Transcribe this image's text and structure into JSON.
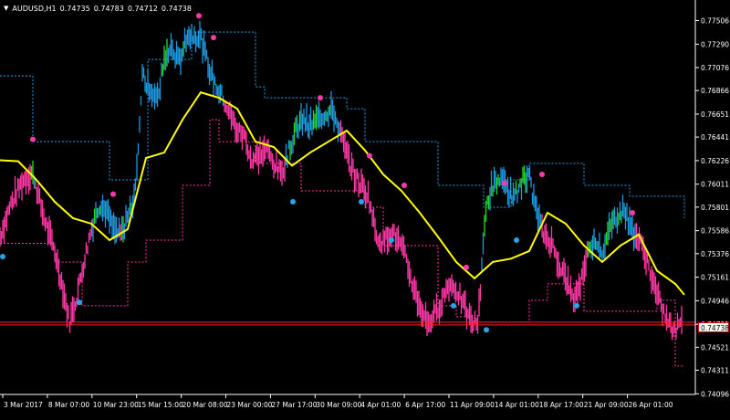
{
  "symbol": "AUDUSD,H1",
  "ohlc": [
    "0.74735",
    "0.74783",
    "0.74712",
    "0.74738"
  ],
  "current_price": "0.74738",
  "colors": {
    "background": "#000000",
    "grid_text": "#ffffff",
    "bull_candles": "#1e9be0",
    "bear_candles": "#ff3aa8",
    "strong_candles": "#22dd22",
    "midline": "#ffff00",
    "upper_band": "#29a4e6",
    "lower_band": "#ff3aa8",
    "price_line": "#ff2222"
  },
  "chart_data": {
    "type": "line",
    "xlabel": "",
    "ylabel": "",
    "ylim": [
      0.7409,
      0.7761
    ],
    "y_ticks": [
      "0.77506",
      "0.77290",
      "0.77076",
      "0.76866",
      "0.76651",
      "0.76441",
      "0.76226",
      "0.76011",
      "0.75801",
      "0.75586",
      "0.75376",
      "0.75161",
      "0.74946",
      "0.74731",
      "0.74521",
      "0.74311",
      "0.74096"
    ],
    "x_ticks": [
      "3 Mar 2017",
      "8 Mar 07:00",
      "10 Mar 23:00",
      "15 Mar 15:00",
      "20 Mar 08:00",
      "23 Mar 00:00",
      "27 Mar 17:00",
      "30 Mar 09:00",
      "4 Apr 01:00",
      "6 Apr 17:00",
      "11 Apr 09:00",
      "14 Apr 01:00",
      "18 Apr 17:00",
      "21 Apr 09:00",
      "26 Apr 01:00"
    ],
    "series": [
      {
        "role": "price",
        "x": [
          0,
          12,
          24,
          36,
          44,
          52,
          60,
          68,
          76,
          84,
          92,
          100,
          108,
          116,
          124,
          132,
          140,
          148,
          156,
          164,
          172,
          180,
          188,
          196,
          204,
          212,
          220,
          228,
          236,
          244,
          252,
          260,
          268,
          276,
          284,
          292,
          300,
          308,
          316,
          324,
          332,
          340,
          348,
          356,
          364,
          372,
          380,
          388,
          396,
          404,
          412,
          420,
          428,
          436,
          444,
          452,
          460,
          468,
          476,
          484,
          492,
          500,
          508,
          516,
          524,
          532,
          540,
          548,
          556,
          564,
          572,
          580,
          588,
          596,
          604,
          612,
          620,
          628,
          636,
          644,
          652,
          660,
          668,
          676,
          684,
          692,
          700,
          708,
          716,
          724,
          732,
          740,
          748
        ],
        "y": [
          0.7553,
          0.7583,
          0.7603,
          0.7613,
          0.7583,
          0.756,
          0.754,
          0.751,
          0.7475,
          0.7498,
          0.753,
          0.756,
          0.758,
          0.7578,
          0.756,
          0.7555,
          0.757,
          0.759,
          0.77,
          0.769,
          0.7675,
          0.7715,
          0.7725,
          0.7712,
          0.7735,
          0.7738,
          0.7735,
          0.771,
          0.7692,
          0.768,
          0.7665,
          0.765,
          0.7645,
          0.7622,
          0.7628,
          0.7633,
          0.762,
          0.761,
          0.763,
          0.765,
          0.766,
          0.7655,
          0.766,
          0.7665,
          0.767,
          0.765,
          0.7628,
          0.761,
          0.76,
          0.759,
          0.7555,
          0.7548,
          0.7558,
          0.755,
          0.7535,
          0.751,
          0.749,
          0.7475,
          0.748,
          0.7495,
          0.751,
          0.7505,
          0.749,
          0.7475,
          0.7475,
          0.758,
          0.76,
          0.7605,
          0.7595,
          0.759,
          0.7603,
          0.7608,
          0.7575,
          0.7555,
          0.7548,
          0.753,
          0.7515,
          0.7495,
          0.751,
          0.754,
          0.755,
          0.754,
          0.756,
          0.7573,
          0.7577,
          0.756,
          0.755,
          0.7535,
          0.751,
          0.749,
          0.7475,
          0.7465,
          0.7485
        ]
      },
      {
        "role": "midline",
        "x": [
          0,
          20,
          40,
          60,
          80,
          100,
          120,
          140,
          160,
          180,
          200,
          220,
          240,
          260,
          280,
          300,
          320,
          340,
          360,
          380,
          400,
          420,
          440,
          460,
          480,
          500,
          520,
          540,
          560,
          580,
          600,
          620,
          640,
          660,
          680,
          700,
          720,
          740,
          750
        ],
        "y": [
          0.7623,
          0.7622,
          0.7605,
          0.7585,
          0.757,
          0.7565,
          0.755,
          0.756,
          0.7625,
          0.763,
          0.766,
          0.7685,
          0.768,
          0.767,
          0.764,
          0.7635,
          0.7618,
          0.763,
          0.764,
          0.765,
          0.7632,
          0.761,
          0.7595,
          0.7575,
          0.7553,
          0.753,
          0.7515,
          0.753,
          0.7533,
          0.754,
          0.7575,
          0.7565,
          0.7545,
          0.753,
          0.7545,
          0.7555,
          0.7522,
          0.751,
          0.75
        ]
      },
      {
        "role": "upper_band",
        "x": [
          0,
          24,
          36,
          90,
          120,
          150,
          162,
          200,
          210,
          240,
          280,
          290,
          330,
          380,
          400,
          440,
          480,
          500,
          530,
          560,
          580,
          610,
          640,
          680,
          690,
          730,
          750
        ],
        "y": [
          0.77,
          0.77,
          0.764,
          0.764,
          0.7605,
          0.7605,
          0.7715,
          0.7715,
          0.774,
          0.774,
          0.769,
          0.768,
          0.768,
          0.767,
          0.764,
          0.764,
          0.76,
          0.76,
          0.758,
          0.7605,
          0.762,
          0.762,
          0.76,
          0.76,
          0.759,
          0.759,
          0.757
        ]
      },
      {
        "role": "lower_band",
        "x": [
          0,
          50,
          60,
          90,
          140,
          160,
          200,
          230,
          240,
          280,
          320,
          330,
          380,
          400,
          420,
          480,
          500,
          520,
          540,
          580,
          600,
          640,
          680,
          720,
          740,
          750
        ],
        "y": [
          0.7547,
          0.7547,
          0.753,
          0.749,
          0.753,
          0.755,
          0.76,
          0.766,
          0.764,
          0.762,
          0.762,
          0.7595,
          0.7595,
          0.758,
          0.7545,
          0.749,
          0.748,
          0.7475,
          0.7475,
          0.7495,
          0.751,
          0.7485,
          0.7485,
          0.7495,
          0.7435,
          0.7435
        ]
      }
    ],
    "fractal_highs": [
      [
        36,
        0.7642
      ],
      [
        124,
        0.7592
      ],
      [
        218,
        0.7755
      ],
      [
        234,
        0.7735
      ],
      [
        351,
        0.768
      ],
      [
        405,
        0.7627
      ],
      [
        443,
        0.76
      ],
      [
        511,
        0.7525
      ],
      [
        553,
        0.7602
      ],
      [
        594,
        0.761
      ],
      [
        693,
        0.7575
      ]
    ],
    "fractal_lows": [
      [
        3,
        0.7535
      ],
      [
        87,
        0.7493
      ],
      [
        321,
        0.7585
      ],
      [
        396,
        0.7585
      ],
      [
        429,
        0.755
      ],
      [
        497,
        0.749
      ],
      [
        533,
        0.7468
      ],
      [
        566,
        0.755
      ],
      [
        632,
        0.749
      ]
    ],
    "grid": false,
    "legend": "none"
  }
}
